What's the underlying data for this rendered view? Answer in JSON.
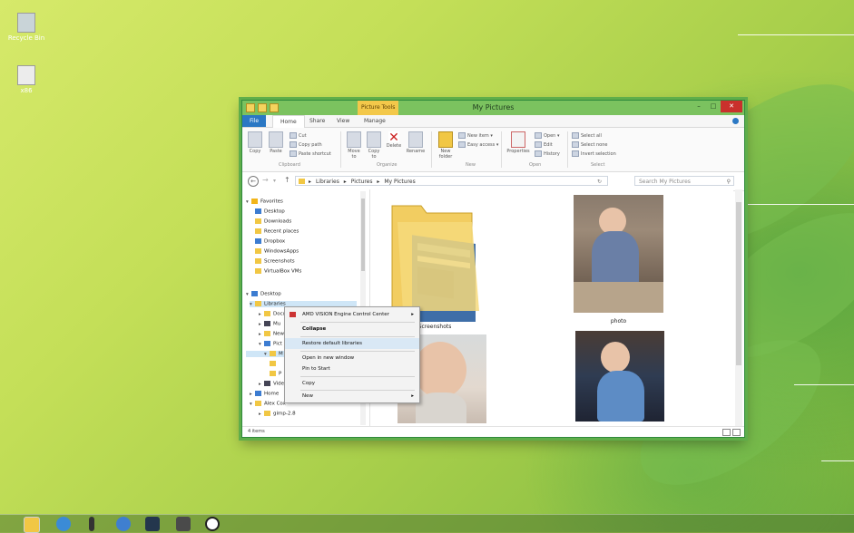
{
  "desktop": {
    "icons": [
      {
        "label": "Recycle Bin",
        "icon": "recycle-bin-icon"
      },
      {
        "label": "x86",
        "icon": "file-icon"
      }
    ]
  },
  "window": {
    "title": "My Pictures",
    "contextual_tab": "Picture Tools",
    "tabs": [
      "File",
      "Home",
      "Share",
      "View",
      "Manage"
    ],
    "ribbon": {
      "copy": "Copy",
      "paste": "Paste",
      "cut": "Cut",
      "copy_path": "Copy path",
      "paste_shortcut": "Paste shortcut",
      "clipboard": "Clipboard",
      "move_to": "Move to",
      "copy_to": "Copy to",
      "delete": "Delete",
      "rename": "Rename",
      "organize": "Organize",
      "new_folder": "New folder",
      "new_item": "New item",
      "easy_access": "Easy access",
      "new": "New",
      "properties": "Properties",
      "open": "Open",
      "edit": "Edit",
      "history": "History",
      "open_group": "Open",
      "select_all": "Select all",
      "select_none": "Select none",
      "invert_selection": "Invert selection",
      "select": "Select"
    },
    "address": {
      "crumbs": [
        "Libraries",
        "Pictures",
        "My Pictures"
      ],
      "search_placeholder": "Search My Pictures"
    },
    "nav_pane": {
      "favorites": {
        "header": "Favorites",
        "items": [
          "Desktop",
          "Downloads",
          "Recent places",
          "Dropbox",
          "WindowsApps",
          "Screenshots",
          "VirtualBox VMs"
        ]
      },
      "desktop": "Desktop",
      "libraries": "Libraries",
      "library_items": [
        "Docu",
        "Mu",
        "New",
        "Pict",
        "M",
        "P",
        "Vide"
      ],
      "homegroup": "Home",
      "user": "Alex Cox",
      "gimp": "gimp-2.8"
    },
    "content": {
      "items": [
        {
          "caption": "Screenshots",
          "type": "folder"
        },
        {
          "caption": "photo",
          "type": "photo"
        },
        {
          "caption": "",
          "type": "photo"
        },
        {
          "caption": "",
          "type": "photo"
        }
      ]
    },
    "status": {
      "count": "4 items"
    }
  },
  "context_menu": {
    "items": [
      {
        "label": "AMD VISION Engine Control Center",
        "submenu": true
      },
      {
        "label": "Collapse",
        "bold": true
      },
      {
        "label": "Restore default libraries",
        "highlight": true
      },
      {
        "label": "Open in new window"
      },
      {
        "label": "Pin to Start"
      },
      {
        "label": "Copy"
      },
      {
        "label": "New",
        "submenu": true
      }
    ]
  },
  "taskbar": {
    "apps": [
      "file-explorer-icon",
      "internet-explorer-icon",
      "phone-icon",
      "chrome-icon",
      "steam-icon",
      "paint-icon",
      "clock-icon"
    ]
  },
  "colors": {
    "accent": "#2b78c4",
    "titlebar": "#7bc25f",
    "close": "#c9302c",
    "desktop": "#b9d94f"
  }
}
